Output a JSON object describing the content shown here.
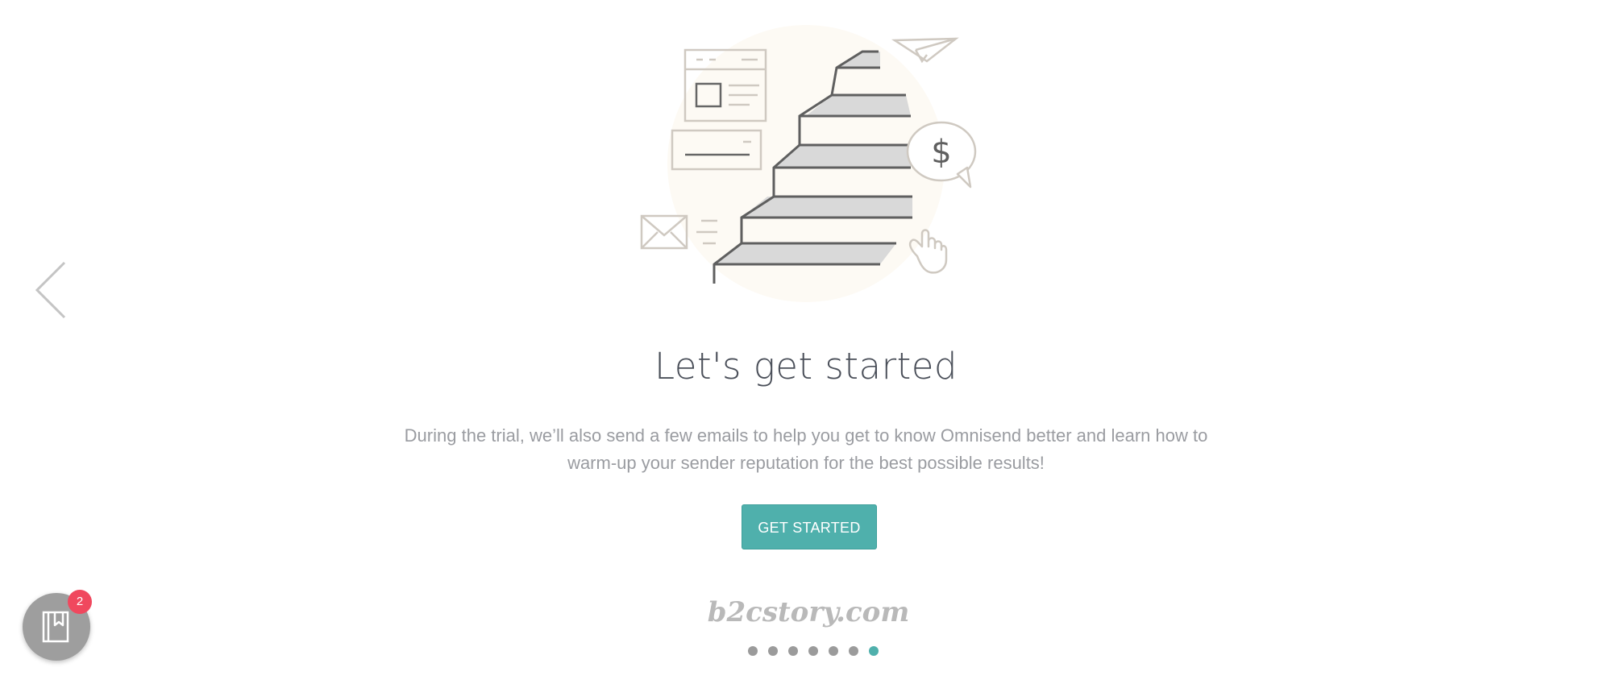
{
  "onboarding": {
    "headline": "Let's get started",
    "body_line1": "During the trial, we’ll also send a few emails to help you get to know Omnisend better and learn how to",
    "body_line2": "warm-up your sender reputation for the best possible results!",
    "cta_label": "GET STARTED",
    "illustration_icons": [
      "newsletter-layout-icon",
      "text-card-icon",
      "envelope-icon",
      "staircase-icon",
      "paper-plane-icon",
      "dollar-speech-bubble-icon",
      "pointing-hand-icon"
    ],
    "illustration_symbol": "$"
  },
  "navigation": {
    "prev_icon": "chevron-left-icon"
  },
  "pager": {
    "total": 7,
    "active_index": 6
  },
  "watermark": "b2cstory.com",
  "bookmark_widget": {
    "icon": "bookmark-book-icon",
    "badge_count": "2"
  },
  "colors": {
    "accent": "#4fb0ac",
    "badge": "#f0485e",
    "heading": "#4a4f59",
    "body": "#9a9ca1",
    "dot_inactive": "#9b9b9b"
  }
}
